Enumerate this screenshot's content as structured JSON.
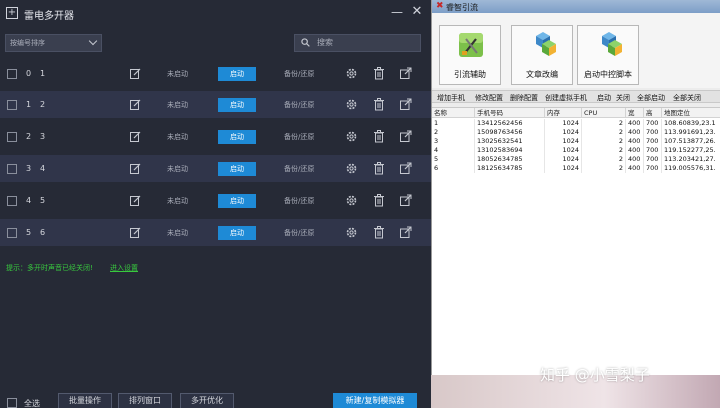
{
  "emulator": {
    "title": "雷电多开器",
    "sort_label": "按编号排序",
    "search_placeholder": "搜索",
    "rows": [
      {
        "index": "0",
        "name": "1",
        "status": "未启动",
        "start": "启动",
        "backup": "备份/还原"
      },
      {
        "index": "1",
        "name": "2",
        "status": "未启动",
        "start": "启动",
        "backup": "备份/还原"
      },
      {
        "index": "2",
        "name": "3",
        "status": "未启动",
        "start": "启动",
        "backup": "备份/还原"
      },
      {
        "index": "3",
        "name": "4",
        "status": "未启动",
        "start": "启动",
        "backup": "备份/还原"
      },
      {
        "index": "4",
        "name": "5",
        "status": "未启动",
        "start": "启动",
        "backup": "备份/还原"
      },
      {
        "index": "5",
        "name": "6",
        "status": "未启动",
        "start": "启动",
        "backup": "备份/还原"
      }
    ],
    "hint": "提示：多开时声音已经关闭!",
    "hint_link": "进入设置",
    "select_all": "全选",
    "buttons": {
      "batch": "批量操作",
      "arrange": "排列窗口",
      "optimize": "多开优化",
      "create": "新建/复制模拟器"
    },
    "accent_color": "#1e8ad6"
  },
  "helper": {
    "title": "睿智引流",
    "toolbar": [
      {
        "label": "引流辅助",
        "icon": "tools-icon"
      },
      {
        "label": "文章改编",
        "icon": "cubes-icon"
      },
      {
        "label": "启动中控脚本",
        "icon": "cubes-icon"
      }
    ],
    "menu": [
      "增加手机",
      "修改配置",
      "删除配置",
      "创建虚拟手机",
      "启动",
      "关闭",
      "全部启动",
      "全部关闭"
    ],
    "columns": [
      "名称",
      "手机号码",
      "内存",
      "CPU",
      "宽",
      "高",
      "地图定位"
    ],
    "rows": [
      [
        "1",
        "13412562456",
        "1024",
        "2",
        "400",
        "700",
        "108.60839,23.1"
      ],
      [
        "2",
        "15098763456",
        "1024",
        "2",
        "400",
        "700",
        "113.991691,23."
      ],
      [
        "3",
        "13025632541",
        "1024",
        "2",
        "400",
        "700",
        "107.513877,26."
      ],
      [
        "4",
        "13102583694",
        "1024",
        "2",
        "400",
        "700",
        "119.152277,25."
      ],
      [
        "5",
        "18052634785",
        "1024",
        "2",
        "400",
        "700",
        "113.203421,27."
      ],
      [
        "6",
        "18125634785",
        "1024",
        "2",
        "400",
        "700",
        "119.005576,31."
      ]
    ]
  },
  "watermark": "知乎 @小雪梨子"
}
